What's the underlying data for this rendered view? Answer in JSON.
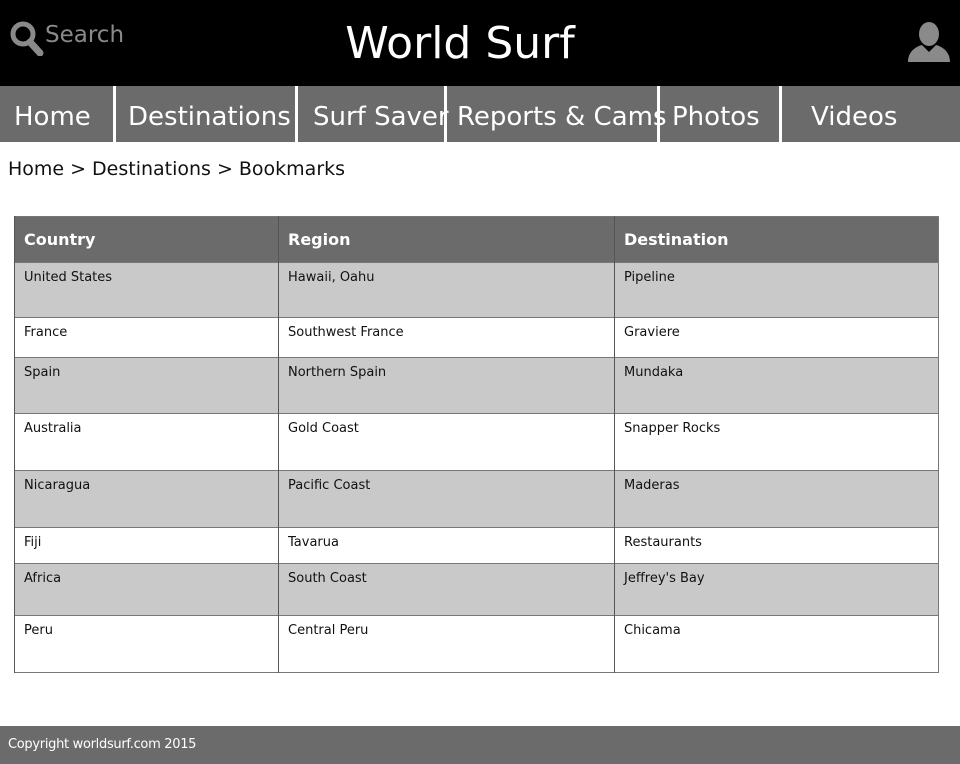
{
  "header": {
    "search_label": "Search",
    "site_title": "World Surf",
    "search_icon": "search-icon",
    "user_icon": "user-icon"
  },
  "nav": {
    "items": [
      {
        "label": "Home"
      },
      {
        "label": "Destinations"
      },
      {
        "label": "Surf Saver"
      },
      {
        "label": "Reports & Cams"
      },
      {
        "label": "Photos"
      },
      {
        "label": "Videos"
      }
    ]
  },
  "breadcrumb": {
    "items": [
      "Home",
      "Destinations",
      "Bookmarks"
    ],
    "separator": ">"
  },
  "table": {
    "columns": [
      "Country",
      "Region",
      "Destination"
    ],
    "rows": [
      [
        "United States",
        "Hawaii, Oahu",
        "Pipeline"
      ],
      [
        "France",
        "Southwest France",
        "Graviere"
      ],
      [
        "Spain",
        "Northern Spain",
        "Mundaka"
      ],
      [
        "Australia",
        "Gold Coast",
        "Snapper Rocks"
      ],
      [
        "Nicaragua",
        "Pacific Coast",
        "Maderas"
      ],
      [
        "Fiji",
        "Tavarua",
        "Restaurants"
      ],
      [
        "Africa",
        "South Coast",
        "Jeffrey's Bay"
      ],
      [
        "Peru",
        "Central Peru",
        "Chicama"
      ]
    ]
  },
  "footer": {
    "text": "Copyright worldsurf.com 2015"
  },
  "colors": {
    "header_bg": "#000000",
    "nav_bg": "#6b6b6b",
    "row_shade": "#c9c9c9",
    "footer_bg": "#6b6b6b"
  }
}
